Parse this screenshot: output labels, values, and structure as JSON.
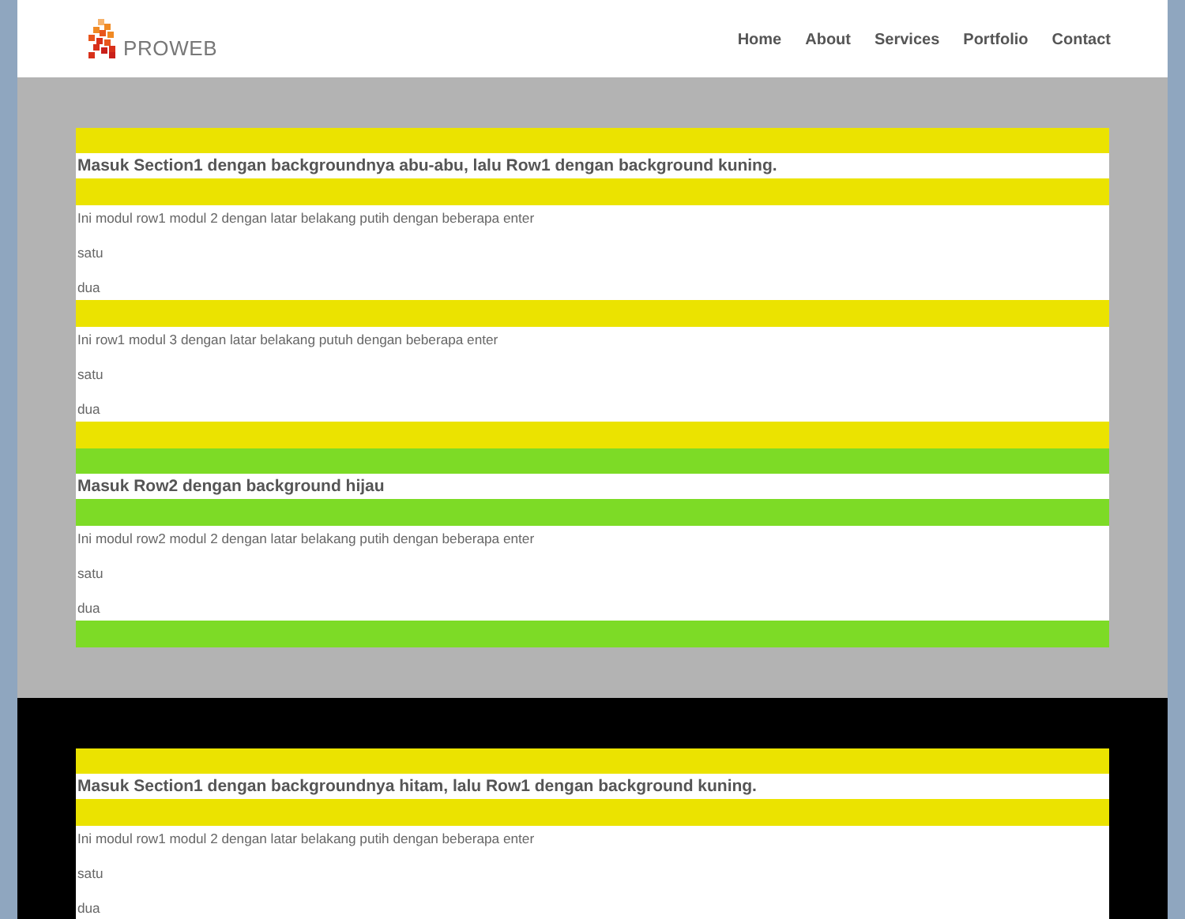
{
  "header": {
    "logo_text": "PROWEB",
    "nav": [
      {
        "label": "Home"
      },
      {
        "label": "About"
      },
      {
        "label": "Services"
      },
      {
        "label": "Portfolio"
      },
      {
        "label": "Contact"
      }
    ]
  },
  "sections": [
    {
      "color": "#b3b3b3",
      "rows": [
        {
          "color": "#ebe300",
          "modules": [
            {
              "kind": "heading",
              "text": "Masuk Section1 dengan backgroundnya abu-abu, lalu Row1 dengan background kuning."
            },
            {
              "kind": "text",
              "lines": [
                "Ini modul row1 modul 2 dengan  latar belakang putih  dengan beberapa enter",
                "satu",
                "dua"
              ]
            },
            {
              "kind": "text",
              "lines": [
                "Ini row1 modul 3 dengan latar belakang putuh dengan beberapa enter",
                "satu",
                "dua"
              ]
            }
          ]
        },
        {
          "color": "#7ddb26",
          "modules": [
            {
              "kind": "heading",
              "text": "Masuk Row2 dengan background hijau"
            },
            {
              "kind": "text",
              "lines": [
                "Ini modul row2 modul 2 dengan  latar belakang putih  dengan beberapa enter",
                "satu",
                "dua"
              ]
            }
          ]
        }
      ]
    },
    {
      "color": "#000000",
      "rows": [
        {
          "color": "#ebe300",
          "modules": [
            {
              "kind": "heading",
              "text": "Masuk Section1 dengan backgroundnya hitam, lalu Row1 dengan background kuning."
            },
            {
              "kind": "text",
              "lines": [
                "Ini modul row1 modul 2 dengan  latar belakang putih  dengan beberapa enter",
                "satu",
                "dua"
              ]
            }
          ]
        }
      ]
    }
  ]
}
